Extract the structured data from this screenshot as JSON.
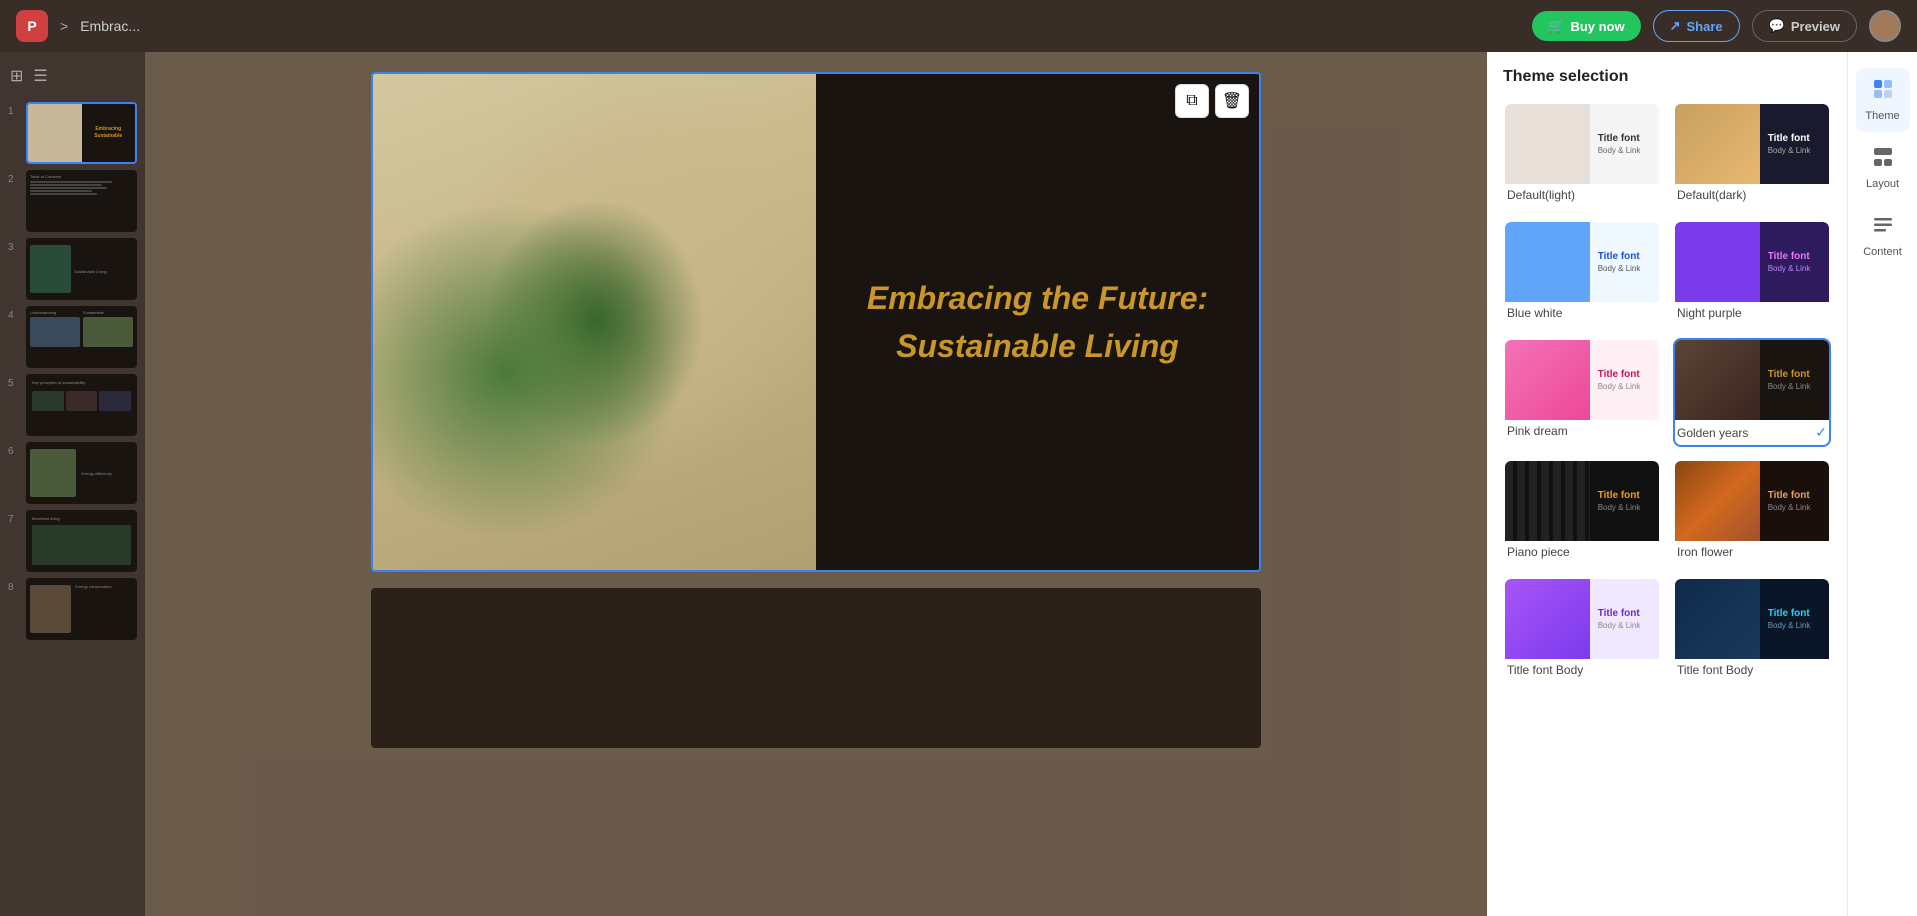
{
  "topbar": {
    "logo_text": "P",
    "breadcrumb_separator": ">",
    "breadcrumb_title": "Embrac...",
    "btn_buy_label": "Buy now",
    "btn_share_label": "Share",
    "btn_preview_label": "Preview"
  },
  "sidebar": {
    "slides": [
      {
        "num": "1",
        "active": true
      },
      {
        "num": "2",
        "active": false
      },
      {
        "num": "3",
        "active": false
      },
      {
        "num": "4",
        "active": false
      },
      {
        "num": "5",
        "active": false
      },
      {
        "num": "6",
        "active": false
      },
      {
        "num": "7",
        "active": false
      },
      {
        "num": "8",
        "active": false
      }
    ]
  },
  "canvas": {
    "main_title_line1": "Embracing the Future:",
    "main_title_line2": "Sustainable Living"
  },
  "theme_panel": {
    "title": "Theme selection",
    "themes": [
      {
        "id": "default-light",
        "name": "Default(light)",
        "selected": false
      },
      {
        "id": "default-dark",
        "name": "Default(dark)",
        "selected": false
      },
      {
        "id": "blue-white",
        "name": "Blue white",
        "selected": false
      },
      {
        "id": "night-purple",
        "name": "Night purple",
        "selected": false
      },
      {
        "id": "pink-dream",
        "name": "Pink dream",
        "selected": false
      },
      {
        "id": "golden-years",
        "name": "Golden years",
        "selected": true
      },
      {
        "id": "piano-piece",
        "name": "Piano piece",
        "selected": false
      },
      {
        "id": "iron-flower",
        "name": "Iron flower",
        "selected": false
      },
      {
        "id": "theme9",
        "name": "Title font Body",
        "selected": false
      },
      {
        "id": "theme10",
        "name": "Title font Body",
        "selected": false
      }
    ]
  },
  "right_icons": [
    {
      "id": "theme",
      "label": "Theme",
      "active": true,
      "symbol": "⊞"
    },
    {
      "id": "layout",
      "label": "Layout",
      "active": false,
      "symbol": "▦"
    },
    {
      "id": "content",
      "label": "Content",
      "active": false,
      "symbol": "≡"
    }
  ],
  "theme_cards": {
    "title_font": "Title font",
    "body_link": "Body & Link"
  }
}
